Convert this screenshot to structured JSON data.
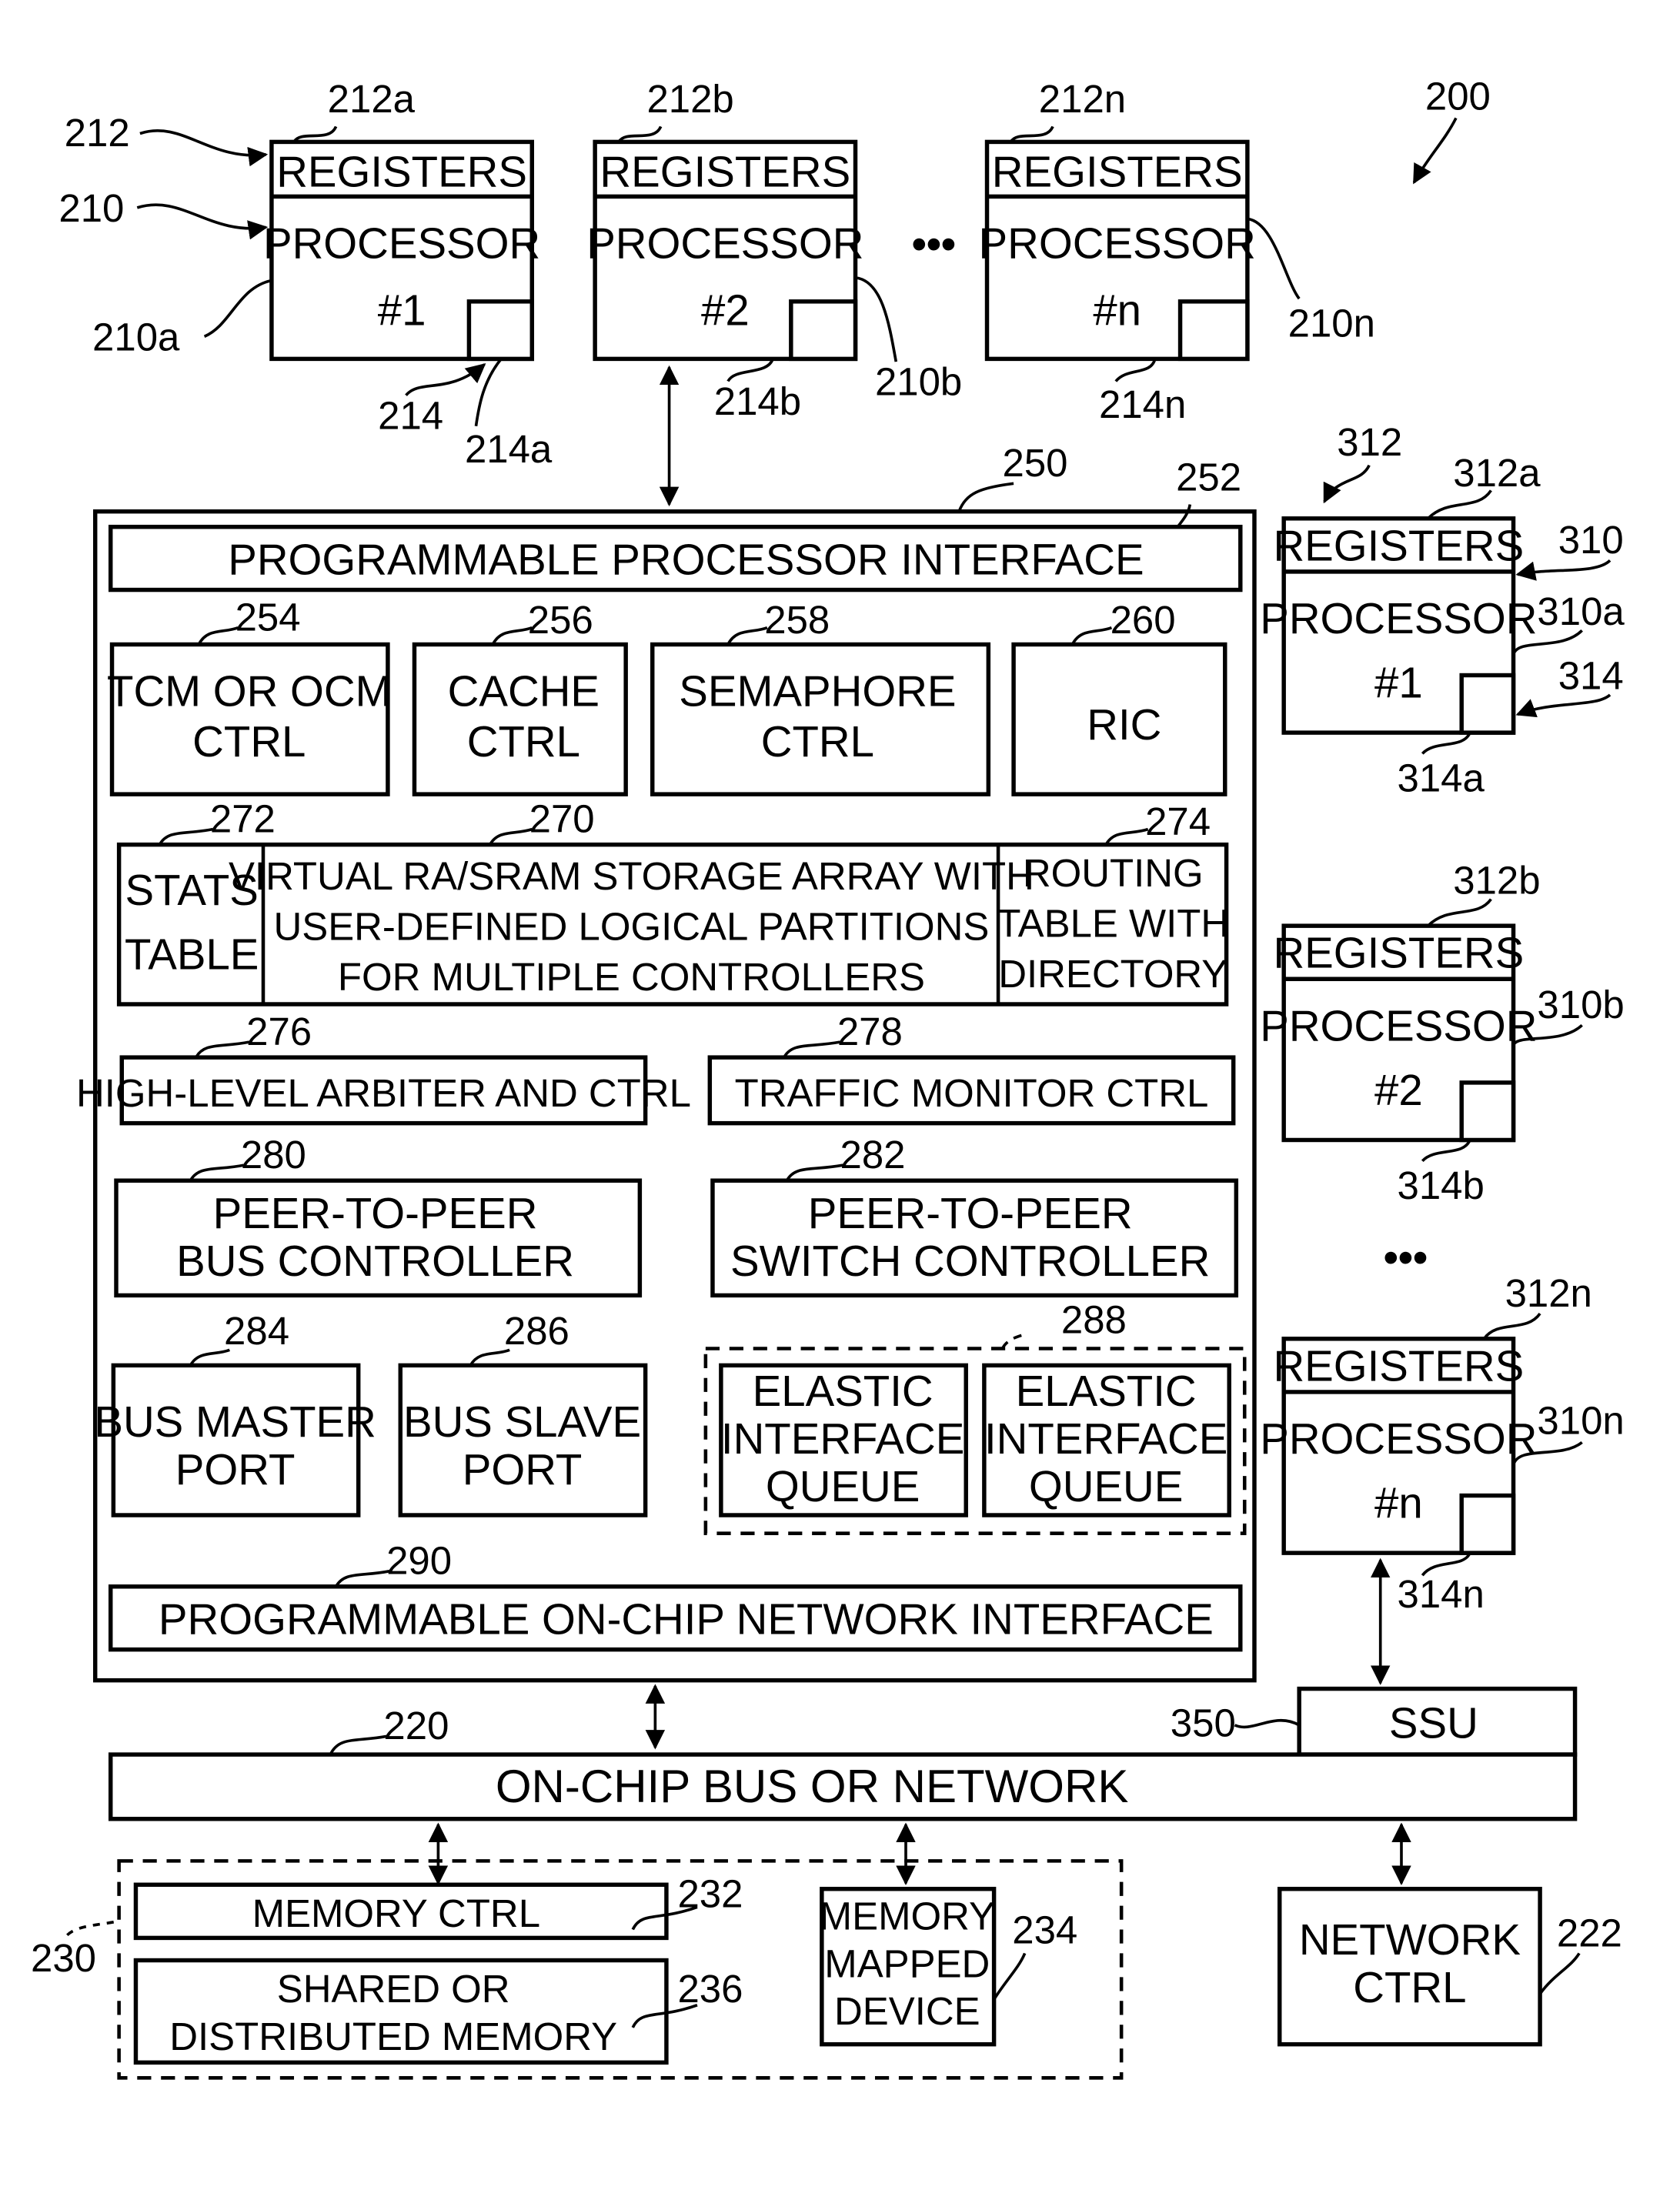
{
  "figure": {
    "ref": "200",
    "processors_top": [
      {
        "registers": "REGISTERS",
        "title": "PROCESSOR",
        "num": "#1",
        "ref_reg": "212a",
        "ref_proc": "210a",
        "ref_cache": "214a"
      },
      {
        "registers": "REGISTERS",
        "title": "PROCESSOR",
        "num": "#2",
        "ref_reg": "212b",
        "ref_proc": "210b",
        "ref_cache": "214b"
      },
      {
        "registers": "REGISTERS",
        "title": "PROCESSOR",
        "num": "#n",
        "ref_reg": "212n",
        "ref_proc": "210n",
        "ref_cache": "214n"
      }
    ],
    "top_group_refs": {
      "registers": "212",
      "processor": "210",
      "cache": "214"
    },
    "ellipsis": "•••",
    "interface_block": {
      "ref": "250",
      "ppi": {
        "label": "PROGRAMMABLE PROCESSOR INTERFACE",
        "ref": "252"
      },
      "row1": [
        {
          "line1": "TCM OR OCM",
          "line2": "CTRL",
          "ref": "254"
        },
        {
          "line1": "CACHE",
          "line2": "CTRL",
          "ref": "256"
        },
        {
          "line1": "SEMAPHORE",
          "line2": "CTRL",
          "ref": "258"
        },
        {
          "line1": "RIC",
          "line2": "",
          "ref": "260"
        }
      ],
      "stats": {
        "line1": "STATS",
        "line2": "TABLE",
        "ref": "272"
      },
      "virtual": {
        "line1": "VIRTUAL RA/SRAM STORAGE ARRAY WITH",
        "line2": "USER-DEFINED LOGICAL PARTITIONS",
        "line3": "FOR MULTIPLE CONTROLLERS",
        "ref": "270"
      },
      "routing": {
        "line1": "ROUTING",
        "line2": "TABLE WITH",
        "line3": "DIRECTORY",
        "ref": "274"
      },
      "arbiter": {
        "label": "HIGH-LEVEL  ARBITER AND CTRL",
        "ref": "276"
      },
      "traffic": {
        "label": "TRAFFIC MONITOR CTRL",
        "ref": "278"
      },
      "p2p_bus": {
        "line1": "PEER-TO-PEER",
        "line2": "BUS CONTROLLER",
        "ref": "280"
      },
      "p2p_switch": {
        "line1": "PEER-TO-PEER",
        "line2": "SWITCH CONTROLLER",
        "ref": "282"
      },
      "bus_master": {
        "line1": "BUS MASTER",
        "line2": "PORT",
        "ref": "284"
      },
      "bus_slave": {
        "line1": "BUS SLAVE",
        "line2": "PORT",
        "ref": "286"
      },
      "elastic_group_ref": "288",
      "elastic": [
        {
          "line1": "ELASTIC",
          "line2": "INTERFACE",
          "line3": "QUEUE"
        },
        {
          "line1": "ELASTIC",
          "line2": "INTERFACE",
          "line3": "QUEUE"
        }
      ],
      "ponni": {
        "label": "PROGRAMMABLE ON-CHIP NETWORK INTERFACE",
        "ref": "290"
      }
    },
    "processors_right": [
      {
        "registers": "REGISTERS",
        "title": "PROCESSOR",
        "num": "#1",
        "ref_reg": "312a",
        "ref_proc": "310a",
        "ref_cache": "314a"
      },
      {
        "registers": "REGISTERS",
        "title": "PROCESSOR",
        "num": "#2",
        "ref_reg": "312b",
        "ref_proc": "310b",
        "ref_cache": "314b"
      },
      {
        "registers": "REGISTERS",
        "title": "PROCESSOR",
        "num": "#n",
        "ref_reg": "312n",
        "ref_proc": "310n",
        "ref_cache": "314n"
      }
    ],
    "right_group_refs": {
      "registers": "312",
      "processor": "310",
      "cache": "314"
    },
    "ssu": {
      "label": "SSU",
      "ref": "350"
    },
    "bus": {
      "label": "ON-CHIP BUS OR NETWORK",
      "ref": "220"
    },
    "memory_group": {
      "ref": "230",
      "memory_ctrl": {
        "label": "MEMORY CTRL",
        "ref": "232"
      },
      "shared_mem": {
        "line1": "SHARED OR",
        "line2": "DISTRIBUTED MEMORY",
        "ref": "236"
      },
      "mmd": {
        "line1": "MEMORY",
        "line2": "MAPPED",
        "line3": "DEVICE",
        "ref": "234"
      }
    },
    "network_ctrl": {
      "line1": "NETWORK",
      "line2": "CTRL",
      "ref": "222"
    }
  }
}
